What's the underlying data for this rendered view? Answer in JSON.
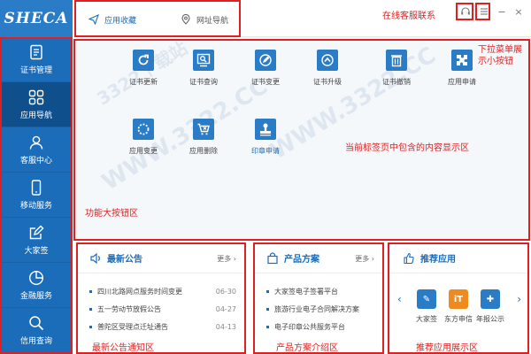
{
  "logo": "SHECA",
  "sidebar": {
    "items": [
      {
        "label": "证书管理",
        "icon": "certificate-doc-icon"
      },
      {
        "label": "应用导航",
        "icon": "apps-grid-icon",
        "active": true
      },
      {
        "label": "客服中心",
        "icon": "person-icon"
      },
      {
        "label": "移动服务",
        "icon": "mobile-phone-icon"
      },
      {
        "label": "大家签",
        "icon": "edit-square-icon"
      },
      {
        "label": "金融服务",
        "icon": "finance-chart-icon"
      },
      {
        "label": "信用查询",
        "icon": "search-icon"
      }
    ]
  },
  "tabs": [
    {
      "label": "应用收藏",
      "icon": "paper-plane-icon",
      "active": true
    },
    {
      "label": "网址导航",
      "icon": "location-pin-icon"
    }
  ],
  "window_controls": {
    "minimize": "−",
    "close": "×"
  },
  "apps": [
    {
      "label": "证书更新",
      "icon": "refresh-icon"
    },
    {
      "label": "证书查询",
      "icon": "search-screen-icon"
    },
    {
      "label": "证书变更",
      "icon": "pencil-circle-icon"
    },
    {
      "label": "证书升级",
      "icon": "upgrade-icon"
    },
    {
      "label": "证书撤销",
      "icon": "trash-icon"
    },
    {
      "label": "应用申请",
      "icon": "puzzle-icon"
    },
    {
      "label": "应用变更",
      "icon": "loading-icon"
    },
    {
      "label": "应用删除",
      "icon": "cart-x-icon"
    },
    {
      "label": "印章申请",
      "icon": "stamp-icon",
      "link": true
    }
  ],
  "annotations": {
    "online_service": "在线客服联系",
    "dropdown_menu": "下拉菜单展示小按钮",
    "content_area": "当前标签页中包含的内容显示区",
    "function_buttons": "功能大按钮区",
    "news_area": "最新公告通知区",
    "product_area": "产品方案介绍区",
    "recommend_area": "推荐应用展示区"
  },
  "news": {
    "title": "最新公告",
    "more": "更多",
    "items": [
      {
        "text": "四川北路网点服务时间变更",
        "date": "06-30"
      },
      {
        "text": "五一劳动节放假公告",
        "date": "04-27"
      },
      {
        "text": "普陀区受理点迁址通告",
        "date": "04-13"
      }
    ]
  },
  "products": {
    "title": "产品方案",
    "more": "更多",
    "items": [
      {
        "text": "大家签电子签署平台"
      },
      {
        "text": "旅游行业电子合同解决方案"
      },
      {
        "text": "电子印章公共服务平台"
      }
    ]
  },
  "recommend": {
    "title": "推荐应用",
    "items": [
      {
        "label": "大家签",
        "color": "#2a7cc7",
        "glyph": "✎"
      },
      {
        "label": "东方申信",
        "color": "#f08a1c",
        "glyph": "iT"
      },
      {
        "label": "年报公示",
        "color": "#2a7cc7",
        "glyph": "✚"
      }
    ]
  },
  "watermark": "WWW.3322.CC",
  "watermark_brand": "3322下载站"
}
